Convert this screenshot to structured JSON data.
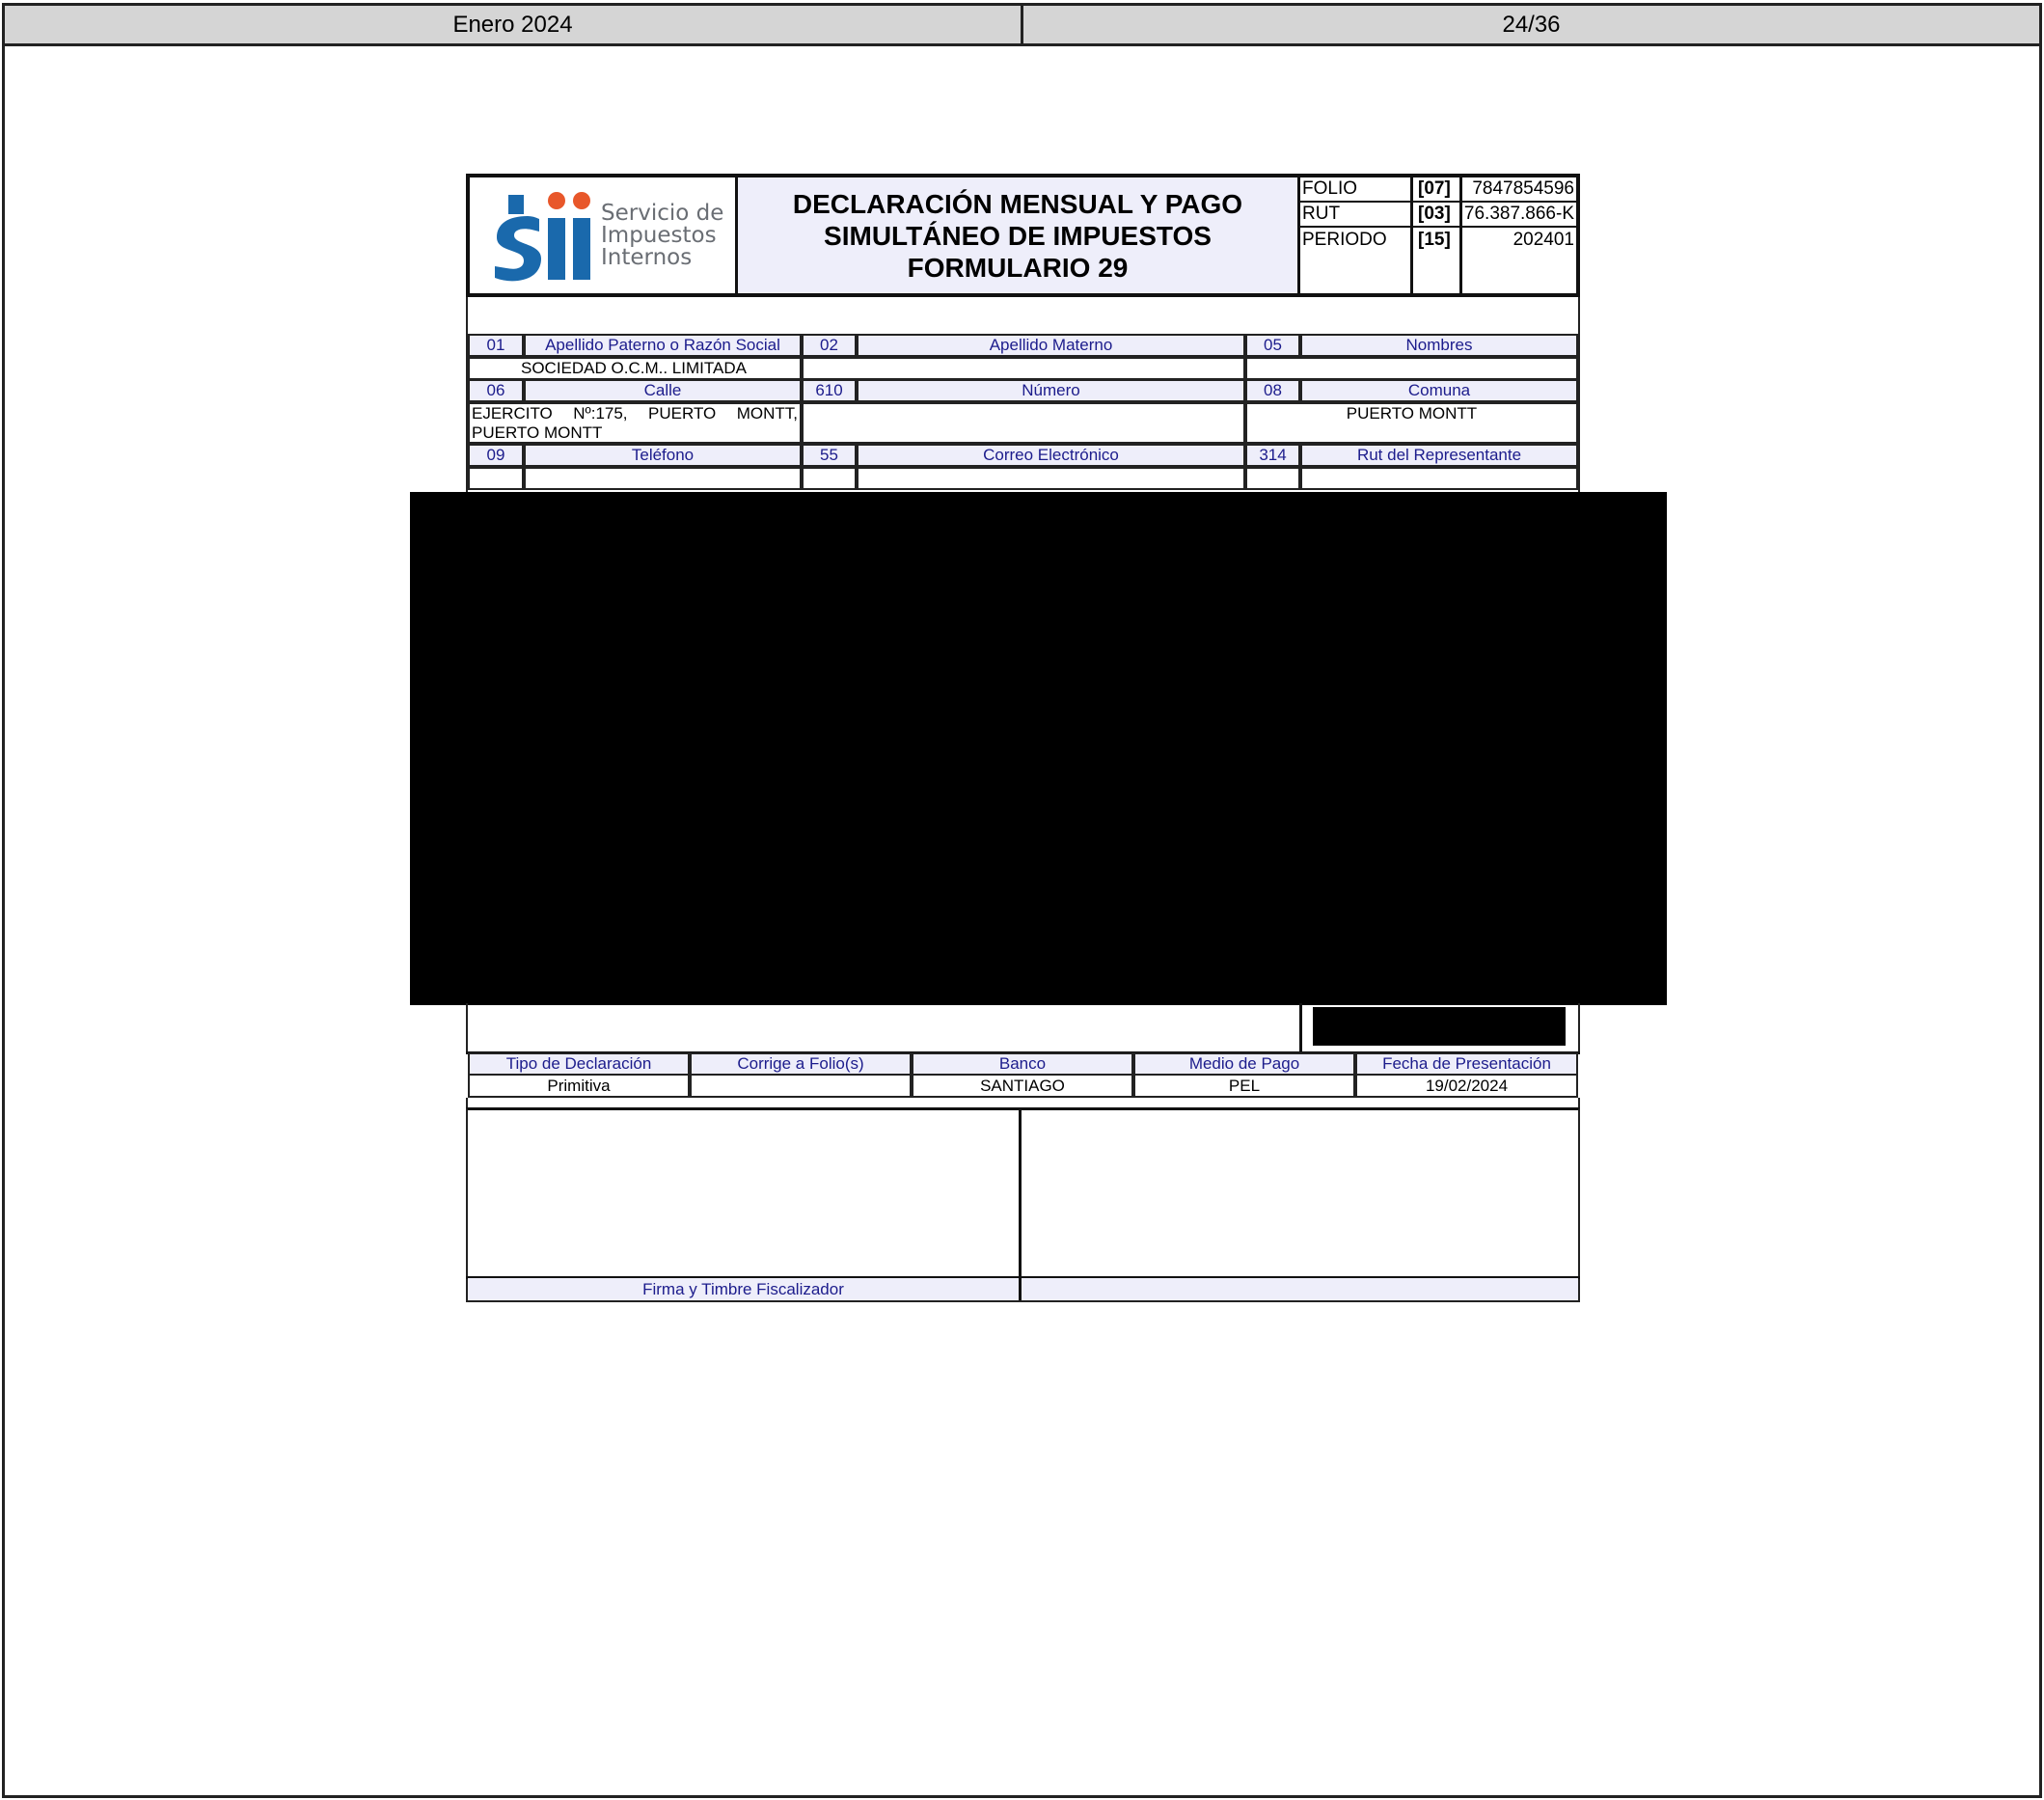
{
  "header": {
    "period": "Enero 2024",
    "page": "24/36"
  },
  "logo": {
    "line1": "Servicio de",
    "line2": "Impuestos",
    "line3": "Internos"
  },
  "form": {
    "title_line1": "DECLARACIÓN MENSUAL Y PAGO",
    "title_line2": "SIMULTÁNEO DE IMPUESTOS",
    "title_line3": "FORMULARIO 29",
    "folio_label": "FOLIO",
    "folio_code": "[07]",
    "folio_value": "7847854596",
    "rut_label": "RUT",
    "rut_code": "[03]",
    "rut_value": "76.387.866-K",
    "periodo_label": "PERIODO",
    "periodo_code": "[15]",
    "periodo_value": "202401"
  },
  "taxpayer": {
    "c01": "01",
    "l01": "Apellido Paterno o Razón Social",
    "c02": "02",
    "l02": "Apellido Materno",
    "c05": "05",
    "l05": "Nombres",
    "razon_social": "SOCIEDAD O.C.M.. LIMITADA",
    "c06": "06",
    "l06": "Calle",
    "c610": "610",
    "l610": "Número",
    "c08": "08",
    "l08": "Comuna",
    "calle_line1": "EJERCITO Nº:175, PUERTO MONTT,",
    "calle_line2": "PUERTO MONTT",
    "comuna": "PUERTO MONTT",
    "c09": "09",
    "l09": "Teléfono",
    "c55": "55",
    "l55": "Correo Electrónico",
    "c314": "314",
    "l314": "Rut del Representante"
  },
  "payment": {
    "tipo_label": "Tipo de Declaración",
    "tipo_value": "Primitiva",
    "corrige_label": "Corrige a Folio(s)",
    "corrige_value": "",
    "banco_label": "Banco",
    "banco_value": "SANTIAGO",
    "medio_label": "Medio de Pago",
    "medio_value": "PEL",
    "fecha_label": "Fecha de Presentación",
    "fecha_value": "19/02/2024"
  },
  "signature": {
    "fiscalizador_label": "Firma y Timbre Fiscalizador"
  },
  "colors": {
    "label_bg": "#eeeefa",
    "label_text": "#1c1c8c",
    "header_bg": "#d5d5d5",
    "logo_blue": "#1a69ac",
    "logo_orange": "#e8572a"
  }
}
